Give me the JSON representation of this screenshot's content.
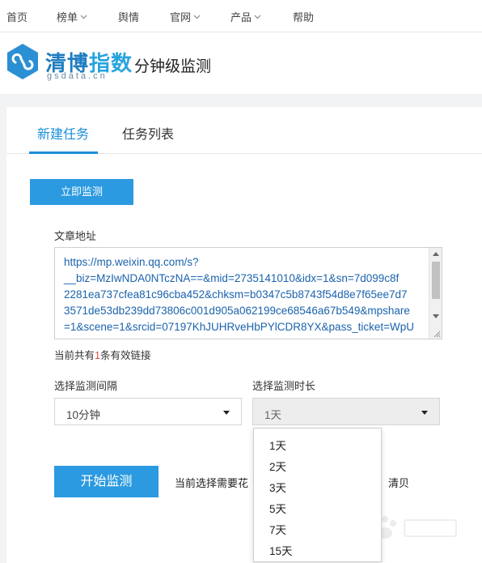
{
  "topnav": {
    "items": [
      {
        "label": "首页"
      },
      {
        "label": "榜单"
      },
      {
        "label": "舆情"
      },
      {
        "label": "官网"
      },
      {
        "label": "产品"
      },
      {
        "label": "帮助"
      }
    ]
  },
  "header": {
    "logo_main": "清博",
    "logo_highlight": "指数",
    "logo_sub": "gsdata.cn",
    "page_title": "分钟级监测"
  },
  "tabs": [
    {
      "label": "新建任务",
      "active": true
    },
    {
      "label": "任务列表",
      "active": false
    }
  ],
  "form": {
    "monitor_now_button": "立即监测",
    "url_label": "文章地址",
    "url_lines": [
      "https://mp.weixin.qq.com/s?",
      "__biz=MzIwNDA0NTczNA==&mid=2735141010&idx=1&sn=7d099c8f",
      "2281ea737cfea81c96cba452&chksm=b0347c5b8743f54d8e7f65ee7d7",
      "3571de53db239dd73806c001d905a062199ce68546a67b549&mpshare",
      "=1&scene=1&srcid=07197KhJUHRveHbPYlCDR8YX&pass_ticket=WpU"
    ],
    "link_count_prefix": "当前共有",
    "link_count_value": "1",
    "link_count_suffix": "条有效链接",
    "interval_label": "选择监测间隔",
    "interval_value": "10分钟",
    "duration_label": "选择监测时长",
    "duration_value": "1天",
    "duration_options": [
      "1天",
      "2天",
      "3天",
      "5天",
      "7天",
      "15天"
    ],
    "start_button": "开始监测",
    "hint_text": "当前选择需要花",
    "hint_tail": "清贝"
  },
  "colors": {
    "primary": "#2b9ae0",
    "tab_active": "#1c8ed8",
    "logo": "#1f7dc0"
  }
}
